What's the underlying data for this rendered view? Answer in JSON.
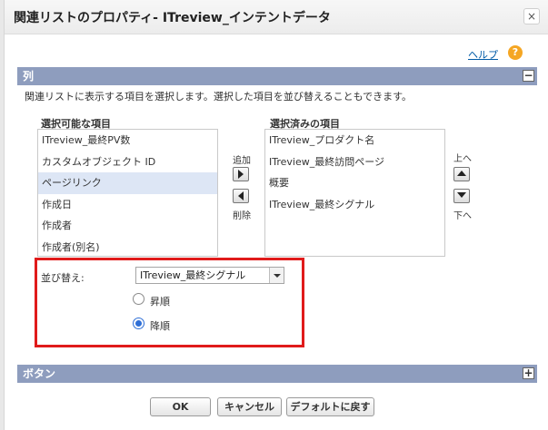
{
  "dialog": {
    "title": "関連リストのプロパティ- ITreview_インテントデータ",
    "close_label": "×"
  },
  "help": {
    "link_text": "ヘルプ",
    "icon_glyph": "?"
  },
  "columns_section": {
    "header": "列",
    "toggle": "−",
    "description": "関連リストに表示する項目を選択します。選択した項目を並び替えることもできます。",
    "available_label": "選択可能な項目",
    "available_items": [
      "ITreview_最終PV数",
      "カスタムオブジェクト ID",
      "ページリンク",
      "作成日",
      "作成者",
      "作成者(別名)"
    ],
    "selected_available_index": 2,
    "selected_label": "選択済みの項目",
    "selected_items": [
      "ITreview_プロダクト名",
      "ITreview_最終訪問ページ",
      "概要",
      "ITreview_最終シグナル"
    ],
    "add_label": "追加",
    "remove_label": "削除",
    "up_label": "上へ",
    "down_label": "下へ"
  },
  "sort": {
    "label": "並び替え:",
    "selected_value": "ITreview_最終シグナル",
    "ascending_label": "昇順",
    "descending_label": "降順",
    "checked": "descending"
  },
  "buttons_section": {
    "header": "ボタン",
    "toggle": "+"
  },
  "footer": {
    "ok_label": "OK",
    "cancel_label": "キャンセル",
    "reset_label": "デフォルトに戻す"
  },
  "colors": {
    "section_header": "#8e9dbe",
    "highlight_border": "#e01b1b",
    "selected_row": "#dde6f5",
    "link": "#015ba7",
    "help_icon": "#f5a623"
  }
}
